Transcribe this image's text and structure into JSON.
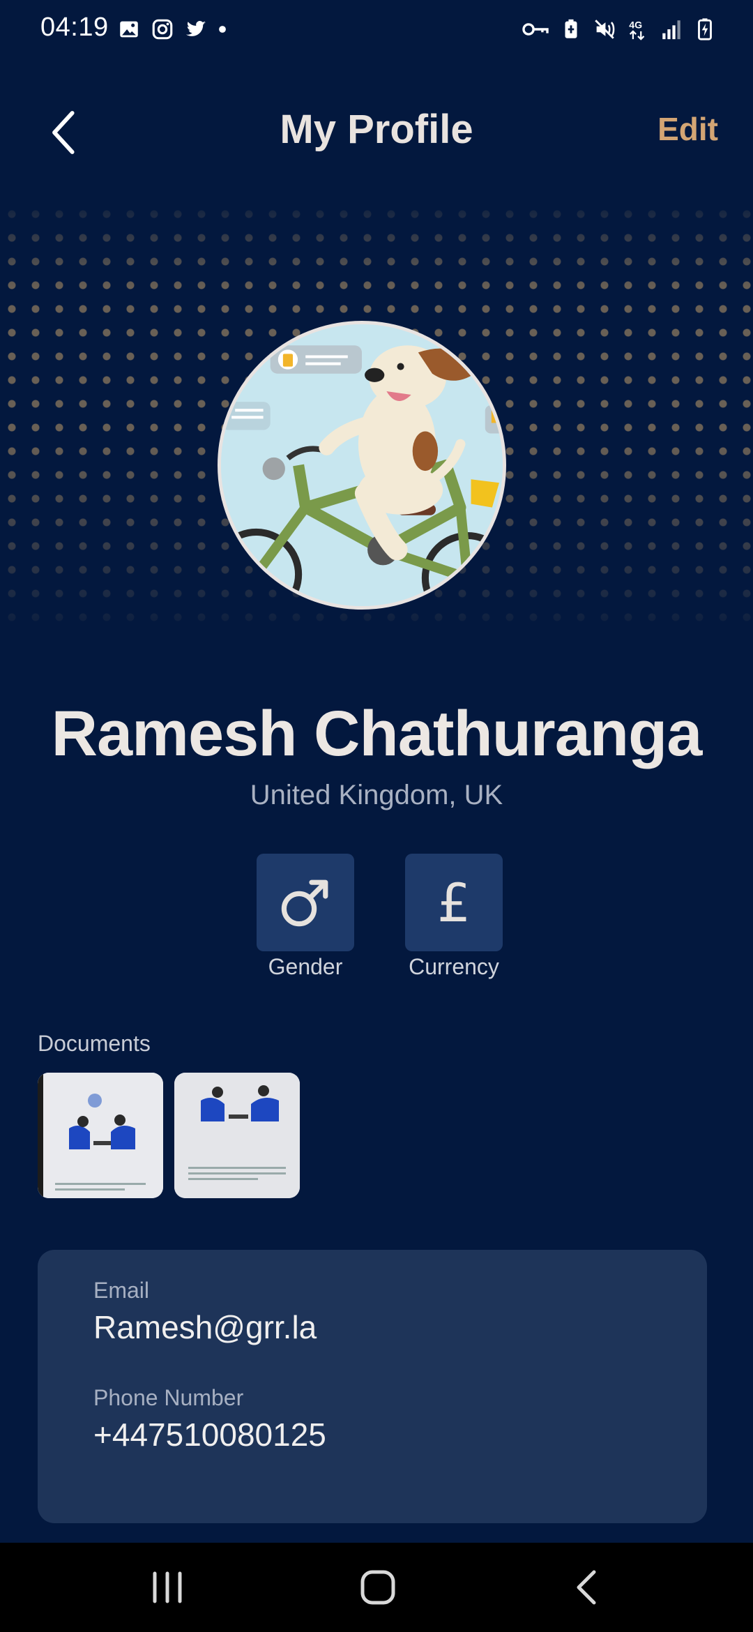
{
  "status_bar": {
    "time": "04:19",
    "left_icons": [
      "gallery-icon",
      "instagram-icon",
      "twitter-icon",
      "dot-icon"
    ],
    "right_icons": [
      "key-icon",
      "battery-saver-icon",
      "mute-icon",
      "network-4g-icon",
      "signal-icon",
      "battery-charging-icon"
    ],
    "network_label": "4G"
  },
  "header": {
    "title": "My Profile",
    "edit_label": "Edit",
    "back_icon": "chevron-left-icon"
  },
  "profile": {
    "name": "Ramesh Chathuranga",
    "location": "United Kingdom, UK",
    "avatar": "dog-on-bicycle-illustration"
  },
  "tiles": {
    "gender": {
      "label": "Gender",
      "icon": "male-symbol-icon"
    },
    "currency": {
      "label": "Currency",
      "icon": "pound-symbol-icon",
      "symbol": "£"
    }
  },
  "documents": {
    "label": "Documents",
    "items": [
      "document-thumbnail-1",
      "document-thumbnail-2"
    ]
  },
  "contact": {
    "email_label": "Email",
    "email_value": "Ramesh@grr.la",
    "phone_label": "Phone Number",
    "phone_value": "+447510080125"
  },
  "nav": [
    "recent-apps-icon",
    "home-icon",
    "back-icon"
  ],
  "colors": {
    "background": "#03183e",
    "accent": "#d3a574",
    "card": "#1e3459",
    "tile": "#1e3a6a",
    "title": "#e9e3df"
  }
}
